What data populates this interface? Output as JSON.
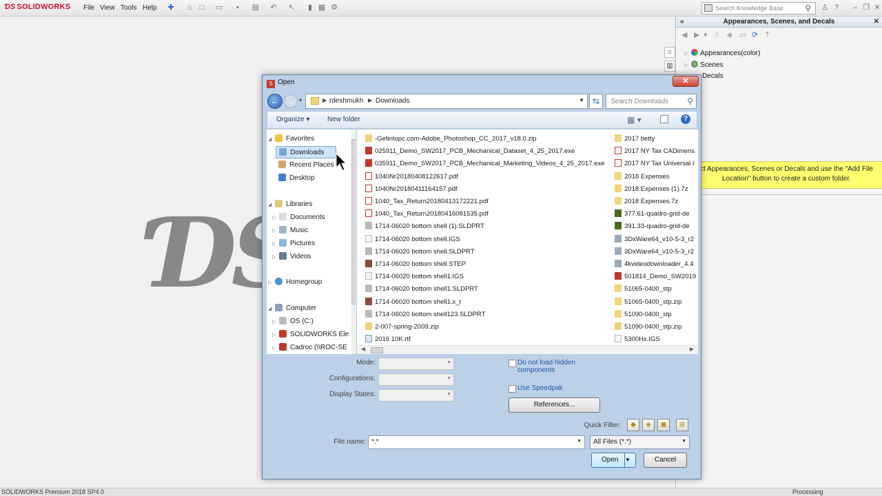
{
  "app": {
    "brand": "SOLIDWORKS",
    "menu": [
      "File",
      "View",
      "Tools",
      "Help"
    ],
    "kb_search_placeholder": "Search Knowledge Base",
    "status_left": "SOLIDWORKS Premium 2018 SP4.0",
    "status_right": "Processing"
  },
  "taskpane": {
    "title": "Appearances, Scenes, and Decals",
    "tree": [
      "Appearances(color)",
      "Scenes",
      "Decals"
    ],
    "tip": "ct Appearances, Scenes or Decals and use the \"Add File Location\" button to create a custom folder."
  },
  "dialog": {
    "title": "Open",
    "breadcrumb": [
      "rdeshmukh",
      "Downloads"
    ],
    "search_placeholder": "Search Downloads",
    "organize_label": "Organize",
    "new_folder_label": "New folder",
    "nav": {
      "favorites": "Favorites",
      "downloads": "Downloads",
      "recent": "Recent Places",
      "desktop": "Desktop",
      "libraries": "Libraries",
      "documents": "Documents",
      "music": "Music",
      "pictures": "Pictures",
      "videos": "Videos",
      "homegroup": "Homegroup",
      "computer": "Computer",
      "os": "OS (C:)",
      "sw_ele": "SOLIDWORKS Ele",
      "cadroc": "Cadroc (\\\\ROC-SE"
    },
    "files_col1": [
      "-Getintopc.com-Adobe_Photoshop_CC_2017_v18.0.zip",
      "025911_Demo_SW2017_PCB_Mechanical_Dataset_4_25_2017.exe",
      "035911_Demo_SW2017_PCB_Mechanical_Marketing_Videos_4_25_2017.exe",
      "1040Nr20180408122617.pdf",
      "1040Nr20180411164157.pdf",
      "1040_Tax_Return20180413172221.pdf",
      "1040_Tax_Return20180416081535.pdf",
      "1714-06020 bottom shell (1).SLDPRT",
      "1714-06020 bottom shell.IGS",
      "1714-06020 bottom shell.SLDPRT",
      "1714-06020 bottom shell.STEP",
      "1714-06020 bottom shell1.IGS",
      "1714-06020 bottom shell1.SLDPRT",
      "1714-06020 bottom shell1.x_t",
      "1714-06020 bottom shell123.SLDPRT",
      "2-007-spring-2009.zip",
      "2016 10K.rtf"
    ],
    "files_col2": [
      "2017 betty",
      "2017 NY Tax CADimens",
      "2017 NY Tax Universal I",
      "2018 Expenses",
      "2018 Expenses (1).7z",
      "2018 Expenses.7z",
      "377.61-quadro-grid-de",
      "391.33-quadro-grid-de",
      "3DxWare64_v10-5-3_r2",
      "3DxWare64_v10-5-3_r2",
      "4kvideodownloader_4.4",
      "501814_Demo_SW2019",
      "51065-0400_stp",
      "51065-0400_stp.zip",
      "51090-0400_stp",
      "51090-0400_stp.zip",
      "5300Hx.IGS"
    ],
    "mode_label": "Mode:",
    "configs_label": "Configurations:",
    "display_states_label": "Display States:",
    "no_hidden_label": "Do not load hidden components",
    "speedpak_label": "Use Speedpak",
    "references_label": "References...",
    "quick_filter_label": "Quick Filter:",
    "file_name_label": "File name:",
    "file_name_value": "*.*",
    "file_type_value": "All Files (*.*)",
    "open_label": "Open",
    "cancel_label": "Cancel"
  }
}
